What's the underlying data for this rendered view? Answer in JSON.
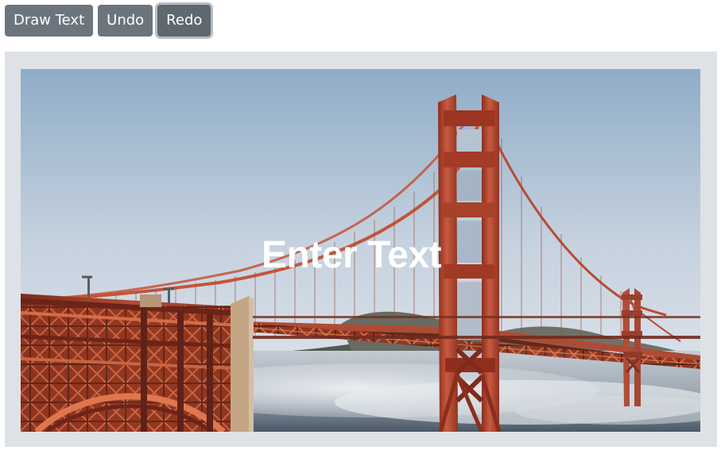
{
  "toolbar": {
    "draw_text_label": "Draw Text",
    "undo_label": "Undo",
    "redo_label": "Redo"
  },
  "canvas": {
    "overlay_text": "Enter Text"
  },
  "colors": {
    "button_bg": "#6c757d",
    "frame_bg": "#dee2e6",
    "bridge_red": "#b84a2f",
    "sky_top": "#92afc9",
    "sky_bottom": "#dde4ee",
    "fog": "#d8dde2"
  }
}
